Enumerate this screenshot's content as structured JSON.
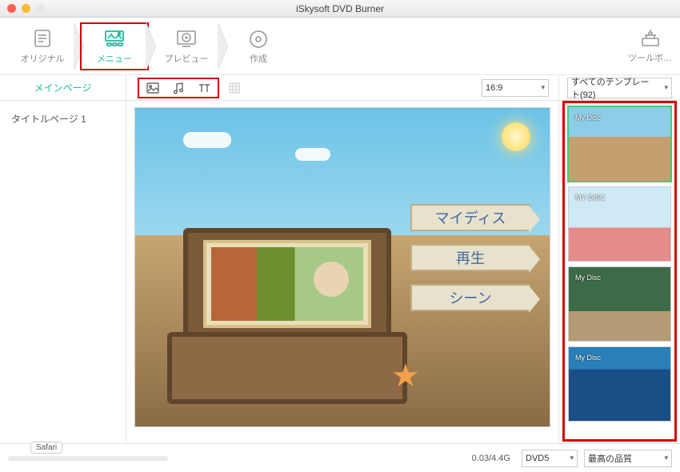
{
  "window": {
    "title": "iSkysoft DVD Burner"
  },
  "steps": {
    "original": "オリジナル",
    "menu": "メニュー",
    "preview": "プレビュー",
    "create": "作成"
  },
  "toolbox_label": "ツールボ…",
  "tabs": {
    "mainpage": "メインページ"
  },
  "left": {
    "title_page": "タイトルページ 1"
  },
  "ratio": {
    "selected": "16:9"
  },
  "templates": {
    "filter_label": "すべてのテンプレート(92)",
    "items": [
      {
        "title": "My Disc"
      },
      {
        "title": "MY DISC"
      },
      {
        "title": "My Disc"
      },
      {
        "title": "My Disc"
      }
    ]
  },
  "menu_preview": {
    "signs": [
      "マイディス",
      "再生",
      "シーン"
    ]
  },
  "bottom": {
    "tooltip": "Safari",
    "size": "0.03/4.4G",
    "disc": "DVD5",
    "quality": "最高の品質"
  }
}
